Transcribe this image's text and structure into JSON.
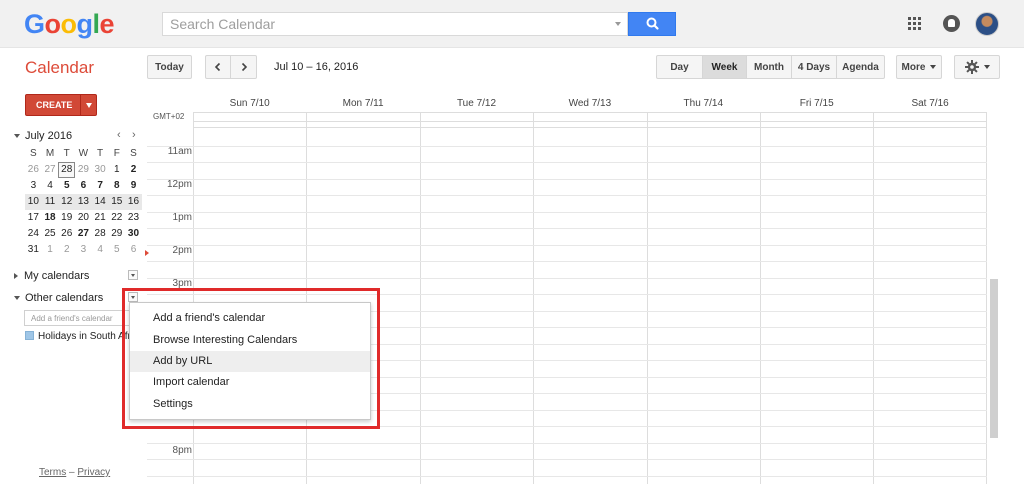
{
  "brand": {
    "logo_letters": [
      {
        "char": "G",
        "color": "#4285f4"
      },
      {
        "char": "o",
        "color": "#ea4335"
      },
      {
        "char": "o",
        "color": "#fbbc05"
      },
      {
        "char": "g",
        "color": "#4285f4"
      },
      {
        "char": "l",
        "color": "#34a853"
      },
      {
        "char": "e",
        "color": "#ea4335"
      }
    ],
    "app_title": "Calendar"
  },
  "search": {
    "placeholder": "Search Calendar",
    "value": ""
  },
  "header_icons": {
    "apps": "apps-grid-icon",
    "notifications": "notifications-icon",
    "avatar": "user-avatar"
  },
  "toolbar": {
    "today_label": "Today",
    "date_range": "Jul 10 – 16, 2016",
    "views": [
      {
        "label": "Day",
        "active": false
      },
      {
        "label": "Week",
        "active": true
      },
      {
        "label": "Month",
        "active": false
      },
      {
        "label": "4 Days",
        "active": false
      },
      {
        "label": "Agenda",
        "active": false
      }
    ],
    "more_label": "More"
  },
  "create_label": "CREATE",
  "mini_calendar": {
    "month_label": "July 2016",
    "prev": "‹",
    "next": "›",
    "weekdays": [
      "S",
      "M",
      "T",
      "W",
      "T",
      "F",
      "S"
    ],
    "weeks": [
      [
        {
          "d": "26",
          "dim": true
        },
        {
          "d": "27",
          "dim": true
        },
        {
          "d": "28",
          "today": true
        },
        {
          "d": "29",
          "dim": true
        },
        {
          "d": "30",
          "dim": true
        },
        {
          "d": "1"
        },
        {
          "d": "2",
          "bold": true
        }
      ],
      [
        {
          "d": "3"
        },
        {
          "d": "4"
        },
        {
          "d": "5",
          "bold": true
        },
        {
          "d": "6",
          "bold": true
        },
        {
          "d": "7",
          "bold": true
        },
        {
          "d": "8",
          "bold": true
        },
        {
          "d": "9",
          "bold": true
        }
      ],
      [
        {
          "d": "10"
        },
        {
          "d": "11"
        },
        {
          "d": "12"
        },
        {
          "d": "13"
        },
        {
          "d": "14"
        },
        {
          "d": "15"
        },
        {
          "d": "16"
        }
      ],
      [
        {
          "d": "17"
        },
        {
          "d": "18",
          "bold": true
        },
        {
          "d": "19"
        },
        {
          "d": "20"
        },
        {
          "d": "21"
        },
        {
          "d": "22"
        },
        {
          "d": "23"
        }
      ],
      [
        {
          "d": "24"
        },
        {
          "d": "25"
        },
        {
          "d": "26"
        },
        {
          "d": "27",
          "bold": true
        },
        {
          "d": "28"
        },
        {
          "d": "29"
        },
        {
          "d": "30",
          "bold": true
        }
      ],
      [
        {
          "d": "31"
        },
        {
          "d": "1",
          "dim": true
        },
        {
          "d": "2",
          "dim": true
        },
        {
          "d": "3",
          "dim": true
        },
        {
          "d": "4",
          "dim": true
        },
        {
          "d": "5",
          "dim": true
        },
        {
          "d": "6",
          "dim": true
        }
      ]
    ],
    "selected_week_index": 2
  },
  "sidebar": {
    "my_calendars": "My calendars",
    "other_calendars": "Other calendars",
    "friend_placeholder": "Add a friend's calendar",
    "holiday_calendar": "Holidays in South Africa",
    "holiday_color": "#9fc6e7",
    "terms": "Terms",
    "privacy": "Privacy"
  },
  "grid": {
    "timezone": "GMT+02",
    "days": [
      "Sun 7/10",
      "Mon 7/11",
      "Tue 7/12",
      "Wed 7/13",
      "Thu 7/14",
      "Fri 7/15",
      "Sat 7/16"
    ],
    "hours": [
      "11am",
      "12pm",
      "1pm",
      "2pm",
      "3pm",
      "8pm"
    ]
  },
  "dropdown_menu": {
    "items": [
      {
        "label": "Add a friend's calendar"
      },
      {
        "label": "Browse Interesting Calendars"
      },
      {
        "label": "Add by URL",
        "hovered": true
      },
      {
        "label": "Import calendar"
      },
      {
        "label": "Settings"
      }
    ]
  },
  "colors": {
    "accent_red": "#dd4b39",
    "search_blue": "#4285f4",
    "highlight_border": "#e02a2a"
  }
}
